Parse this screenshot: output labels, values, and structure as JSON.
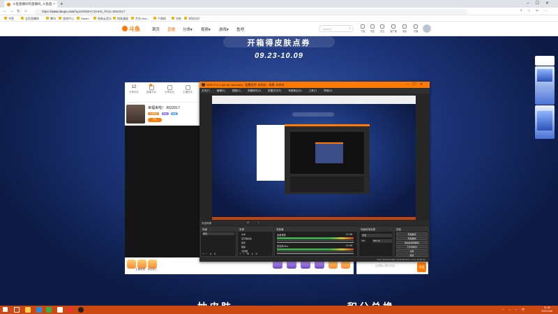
{
  "browser": {
    "tab_title": "斗鱼直播间的直播间_斗鱼直",
    "url_prefix": "https://",
    "url_domain": "www.douyu.com",
    "url_path": "/topic/MDBYCSHHX_Ftioz=8922017",
    "bookmarks": [
      "书签",
      "全民直播网",
      "腾讯",
      "游戏中心",
      "Steam",
      "网易云音乐",
      "网易漫画",
      "京东 Mac...",
      "千图网",
      "学前",
      "学校访问"
    ]
  },
  "site": {
    "logo": "斗鱼",
    "nav": [
      "首页",
      "直播",
      "分类▾",
      "视频▾",
      "游戏▾",
      "鱼吧"
    ],
    "search_placeholder": "search",
    "header_icons": [
      "下载",
      "历史",
      "关注",
      "客户端",
      "消息",
      "开播"
    ]
  },
  "banner": {
    "title": "开箱得皮肤点券",
    "date": "09.23-10.09"
  },
  "streamer": {
    "stats": [
      {
        "num": "12",
        "label": "分享好礼"
      },
      {
        "num": "",
        "label": "直播节目"
      },
      {
        "num": "",
        "label": "分享到位"
      },
      {
        "num": "",
        "label": "主播任务"
      }
    ],
    "name": "幸福来啦！ 8922017",
    "category": "神武",
    "tags": [
      "主播等级",
      "粉丝",
      "热度"
    ],
    "follow": "关注"
  },
  "bottom": {
    "hint": "主播语音，欢迎进入",
    "desc": "当前礼物"
  },
  "chat": {
    "placeholder": "这里输入聊天内容",
    "send": "发送"
  },
  "bottom_banner": [
    "抽皮肤",
    "积分兑换"
  ],
  "obs": {
    "title": "OBS 27.0.1 (64-bit, windows) - 配置文件: 未命名 - 场景: 未命名",
    "menu": [
      "文件(F)",
      "编辑(E)",
      "视图(V)",
      "停靠部件(D)",
      "配置文件(P)",
      "场景集合(S)",
      "工具(T)",
      "帮助(H)"
    ],
    "scene_bar": "未选择源",
    "docks": {
      "scenes": "场景",
      "sources": "来源",
      "mixer": "混音器",
      "transitions": "场景转场效果",
      "controls": "控制"
    },
    "scene_item": "场景",
    "sources": [
      "文本",
      "显示器采集",
      "颜色",
      "图像",
      "浏览器"
    ],
    "mixer_channels": [
      {
        "name": "桌面音频",
        "db": "0.0 dB"
      },
      {
        "name": "麦克风/Aux",
        "db": "0.0 dB"
      }
    ],
    "transition": {
      "type": "淡出",
      "duration_label": "时长",
      "duration": "300 ms"
    },
    "controls": [
      "开始推流",
      "开始录制",
      "启动虚拟摄像机",
      "工作室模式",
      "设置",
      "退出"
    ],
    "status": "LIVE: 00:00:00    REC: 00:00:00    CPU: 3.7%, 30.00 fps"
  },
  "taskbar": {
    "clock_time": "21:40",
    "clock_date": "2021/10/6"
  }
}
